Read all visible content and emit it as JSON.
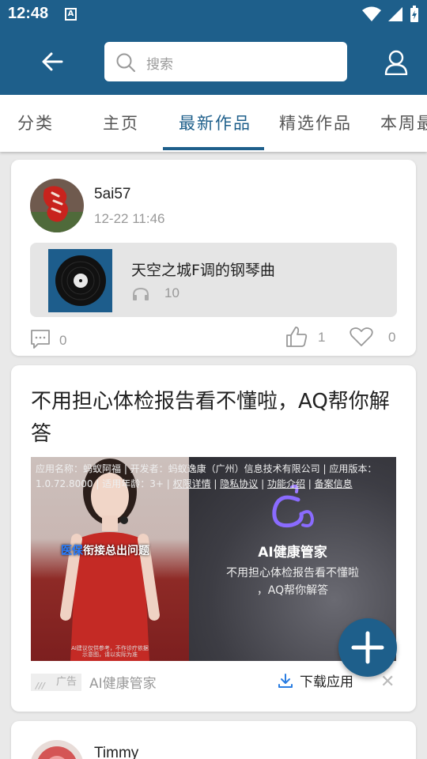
{
  "status_bar": {
    "time": "12:48",
    "notification_badge": "A"
  },
  "toolbar": {
    "search_placeholder": "搜索"
  },
  "tabs": [
    {
      "label": "分类"
    },
    {
      "label": "主页"
    },
    {
      "label": "最新作品",
      "active": true
    },
    {
      "label": "精选作品"
    },
    {
      "label": "本周最"
    }
  ],
  "colors": {
    "primary": "#1e5f8b",
    "background": "#e9e9e9"
  },
  "posts": [
    {
      "username": "5ai57",
      "time": "12-22 11:46",
      "song": {
        "title": "天空之城F调的钢琴曲",
        "listens": "10"
      },
      "comments": "0",
      "likes": "1",
      "favorites": "0"
    },
    {
      "username": "Timmy"
    }
  ],
  "ad": {
    "title": "不用担心体检报告看不懂啦，AQ帮你解答",
    "meta_text": "应用名称：蚂蚁阿福 | 开发者：蚂蚁逸康（广州）信息技术有限公司 | 应用版本：1.0.72.8000 | 适用年龄：3+ |",
    "meta_links": [
      "权限详情",
      "隐私协议",
      "功能介绍",
      "备案信息"
    ],
    "caption_highlight": "医保",
    "caption_rest": "衔接总出问题",
    "brand": "AI健康管家",
    "subtitle_line1": "不用担心体检报告看不懂啦",
    "subtitle_line2": "，AQ帮你解答",
    "footnote_line1": "AI建议仅供参考，不作诊疗依据",
    "footnote_line2": "示意图，请以实际为准",
    "tag_label": "广告",
    "advertiser": "AI健康管家",
    "download_label": "下载应用",
    "close_symbol": "✕"
  },
  "fab": {
    "icon": "plus-icon"
  }
}
